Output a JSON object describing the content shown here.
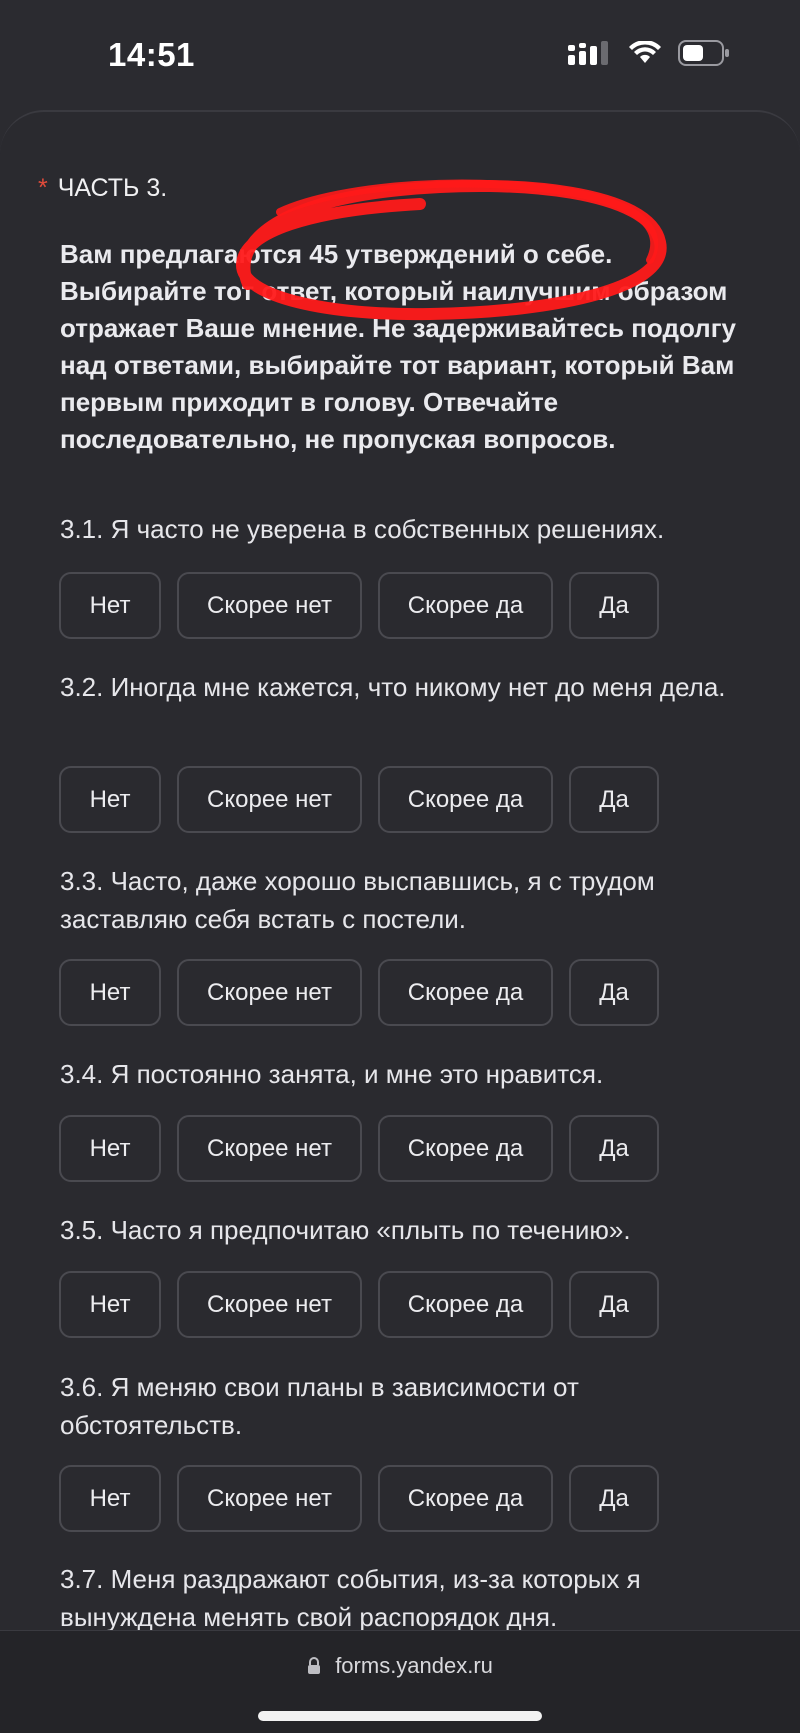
{
  "status_bar": {
    "time": "14:51",
    "icons": [
      "signal-icon",
      "wifi-icon",
      "battery-icon"
    ]
  },
  "form": {
    "required_mark": "*",
    "section_title": "ЧАСТЬ 3.",
    "intro": "Вам предлагаются 45 утверждений о себе. Выбирайте тот ответ, который наилучшим образом отражает Ваше мнение. Не задерживайтесь подолгу над ответами, выбирайте тот вариант, который Вам первым приходит в голову. Отвечайте последовательно, не пропуская вопросов.",
    "annotation_color": "#ff1a1a",
    "options": [
      "Нет",
      "Скорее нет",
      "Скорее да",
      "Да"
    ],
    "questions": [
      {
        "text": "3.1. Я часто не уверена в собственных решениях."
      },
      {
        "text": "3.2. Иногда мне кажется, что никому нет до меня дела."
      },
      {
        "text": "3.3. Часто, даже хорошо выспавшись, я с трудом заставляю себя встать с постели."
      },
      {
        "text": "3.4. Я постоянно занята, и мне это нравится."
      },
      {
        "text": "3.5. Часто я предпочитаю «плыть по течению»."
      },
      {
        "text": "3.6. Я меняю свои планы в зависимости от обстоятельств."
      },
      {
        "text": "3.7. Меня раздражают события, из-за которых я вынуждена менять свой распорядок дня."
      }
    ]
  },
  "browser": {
    "url": "forms.yandex.ru",
    "lock_icon": "lock-icon"
  },
  "colors": {
    "background": "#2b2b30",
    "required": "#e24b3b",
    "button_border": "#4a4a50"
  }
}
